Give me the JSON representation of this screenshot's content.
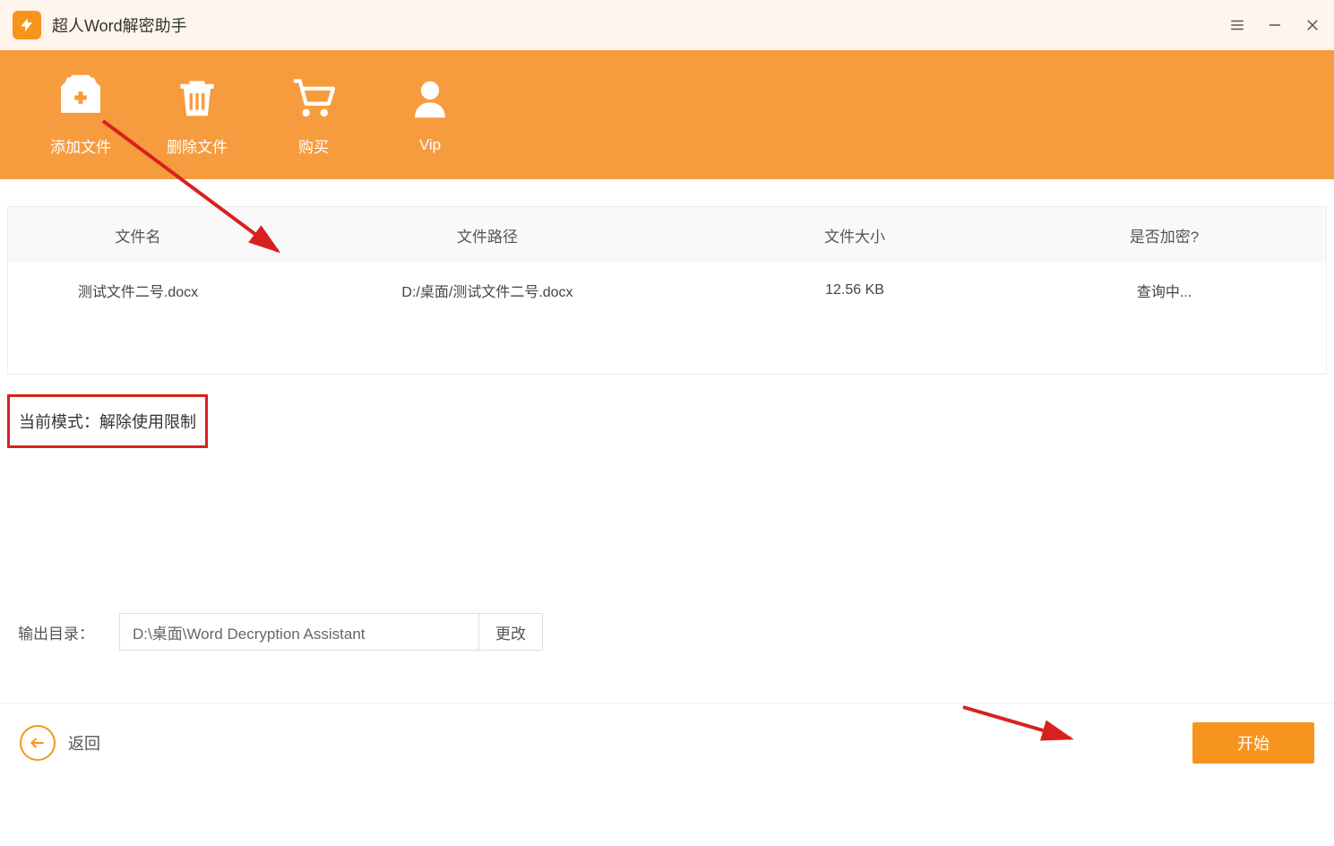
{
  "app": {
    "title": "超人Word解密助手"
  },
  "toolbar": {
    "add_file": "添加文件",
    "delete_file": "删除文件",
    "buy": "购买",
    "vip": "Vip"
  },
  "table": {
    "headers": {
      "filename": "文件名",
      "filepath": "文件路径",
      "filesize": "文件大小",
      "encrypted": "是否加密?"
    },
    "rows": [
      {
        "filename": "测试文件二号.docx",
        "filepath": "D:/桌面/测试文件二号.docx",
        "filesize": "12.56 KB",
        "encrypted": "查询中..."
      }
    ]
  },
  "mode": {
    "text": "当前模式：解除使用限制"
  },
  "output": {
    "label": "输出目录：",
    "value": "D:\\桌面\\Word Decryption Assistant",
    "change": "更改"
  },
  "footer": {
    "back": "返回",
    "start": "开始"
  }
}
